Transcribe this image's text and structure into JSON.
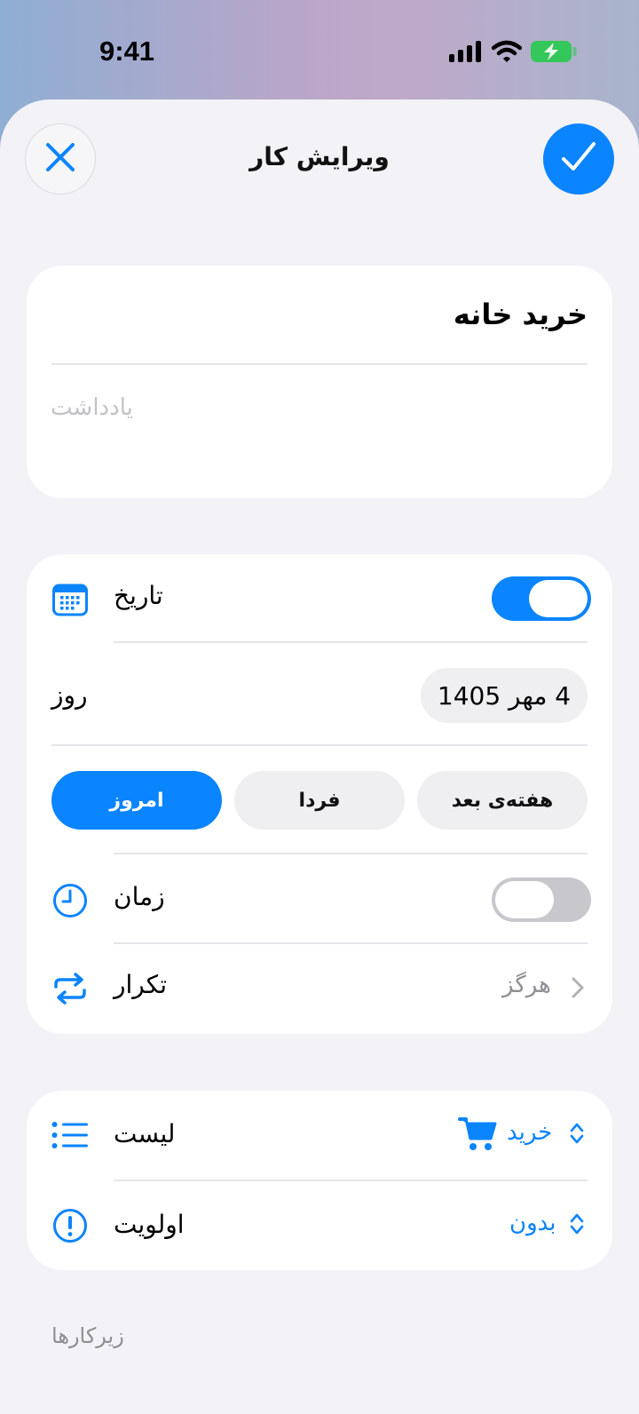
{
  "status_bar": {
    "time": "9:41",
    "icons": [
      "cellular-signal-icon",
      "wifi-icon",
      "battery-charging-icon"
    ],
    "battery_color": "#34c759"
  },
  "nav": {
    "title": "ویرایش کار",
    "close_icon": "close-icon",
    "done_icon": "checkmark-icon"
  },
  "task": {
    "title": "خرید خانه",
    "notes_placeholder": "یادداشت"
  },
  "date_section": {
    "date_label": "تاریخ",
    "date_icon": "calendar-icon",
    "date_enabled": true,
    "day_label": "روز",
    "day_value": "4 مهر 1405",
    "quick_picks": [
      {
        "label": "امروز",
        "selected": true
      },
      {
        "label": "فردا",
        "selected": false
      },
      {
        "label": "هفته‌ی بعد",
        "selected": false
      }
    ],
    "time_label": "زمان",
    "time_icon": "clock-icon",
    "time_enabled": false,
    "repeat_label": "تکرار",
    "repeat_icon": "repeat-icon",
    "repeat_value": "هرگز"
  },
  "list_section": {
    "list_label": "لیست",
    "list_icon": "list-icon",
    "list_value": "خرید",
    "list_value_icon": "shopping-cart-icon",
    "priority_label": "اولویت",
    "priority_icon": "exclamation-circle-icon",
    "priority_value": "بدون"
  },
  "subtasks": {
    "header": "زیرکارها"
  },
  "colors": {
    "accent": "#0a84ff",
    "sheet_background": "#f2f2f7",
    "toggle_off": "#c7c7cc"
  }
}
